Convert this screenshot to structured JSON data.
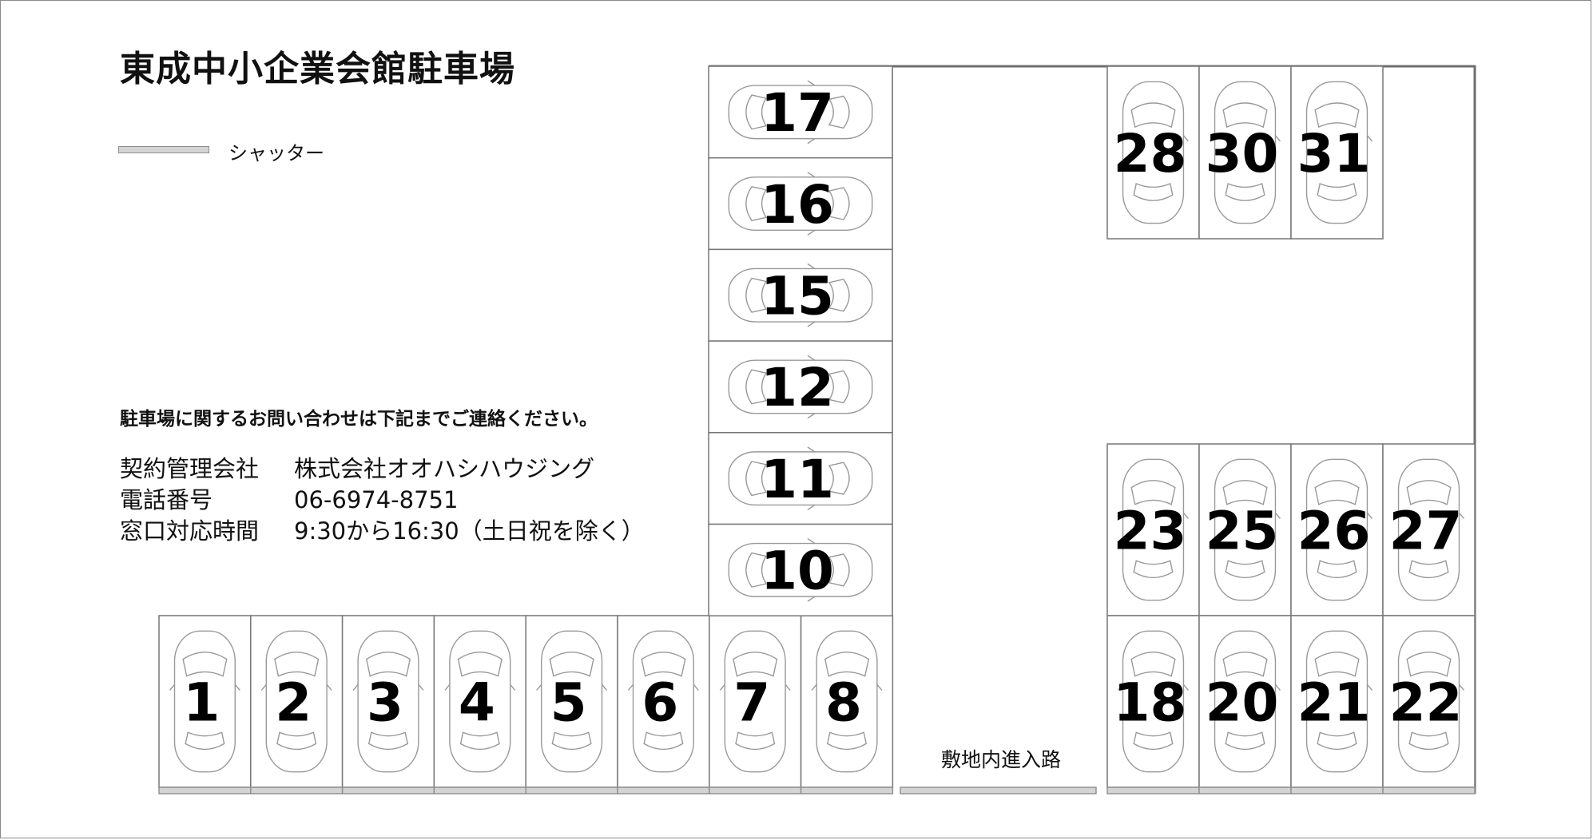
{
  "title": "東成中小企業会館駐車場",
  "legend": {
    "shutter_label": "シャッター",
    "shutter_color": "#d4d4d4"
  },
  "contact": {
    "heading": "駐車場に関するお問い合わせは下記までご連絡ください。",
    "rows": [
      {
        "key": "契約管理会社",
        "value": "株式会社オオハシハウジング"
      },
      {
        "key": "電話番号",
        "value": "06-6974-8751"
      },
      {
        "key": "窓口対応時間",
        "value": "9:30から16:30（土日祝を除く）"
      }
    ]
  },
  "road_label": "敷地内進入路",
  "spaces": {
    "bottom_row": [
      "1",
      "2",
      "3",
      "4",
      "5",
      "6",
      "7",
      "8"
    ],
    "left_column": [
      "17",
      "16",
      "15",
      "12",
      "11",
      "10"
    ],
    "top_right": [
      "28",
      "30",
      "31"
    ],
    "right_upper": [
      "23",
      "25",
      "26",
      "27"
    ],
    "right_lower": [
      "18",
      "20",
      "21",
      "22"
    ]
  }
}
